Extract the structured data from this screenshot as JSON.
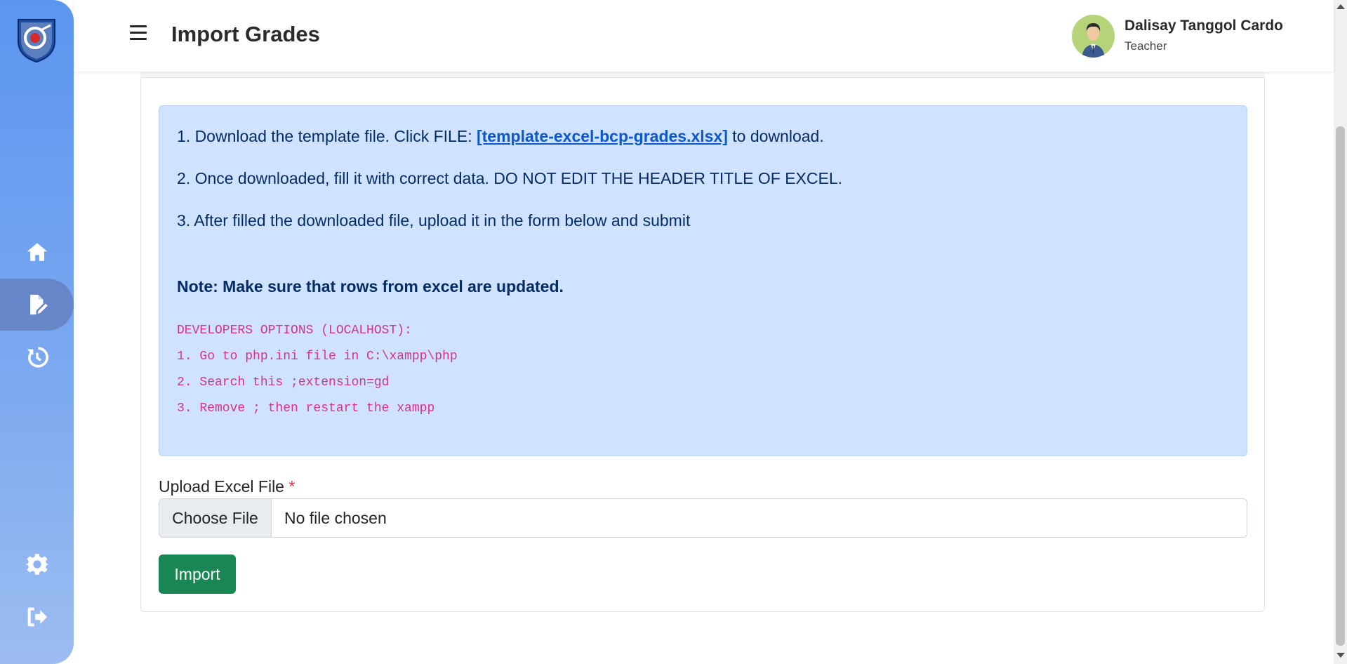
{
  "header": {
    "title": "Import Grades",
    "user_name": "Dalisay Tanggol Cardo",
    "user_role": "Teacher"
  },
  "sidebar": {
    "items": [
      {
        "name": "home-icon"
      },
      {
        "name": "file-edit-icon"
      },
      {
        "name": "history-icon"
      },
      {
        "name": "gear-icon"
      },
      {
        "name": "logout-icon"
      }
    ]
  },
  "instructions": {
    "step1_prefix": "1. Download the template file. Click FILE: ",
    "step1_link": "[template-excel-bcp-grades.xlsx]",
    "step1_suffix": " to download.",
    "step2": "2. Once downloaded, fill it with correct data. DO NOT EDIT THE HEADER TITLE OF EXCEL.",
    "step3": "3. After filled the downloaded file, upload it in the form below and submit",
    "note": "Note: Make sure that rows from excel are updated.",
    "dev_title": "DEVELOPERS OPTIONS (LOCALHOST):",
    "dev1": "1. Go to php.ini file in C:\\xampp\\php",
    "dev2": "2. Search this ;extension=gd",
    "dev3": "3. Remove ; then restart the xampp"
  },
  "form": {
    "upload_label": "Upload Excel File",
    "required_mark": "*",
    "choose_button": "Choose File",
    "file_status": "No file chosen",
    "import_button": "Import"
  },
  "colors": {
    "sidebar_top": "#5b95f0",
    "info_bg": "#cfe2ff",
    "link": "#0a58ca",
    "code": "#d63384",
    "import_btn": "#198754"
  }
}
